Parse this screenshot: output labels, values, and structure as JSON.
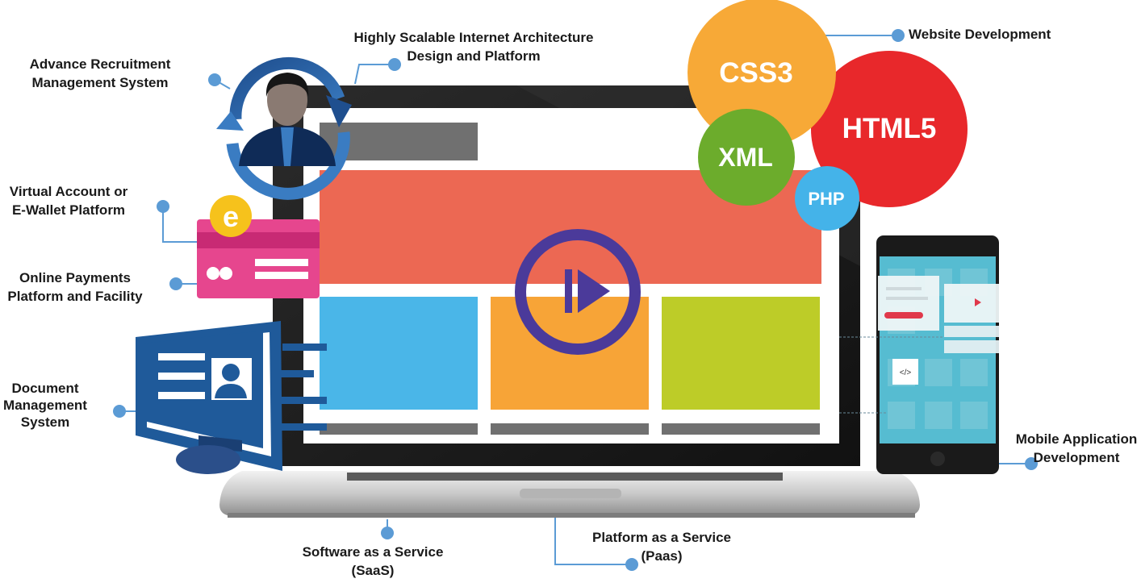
{
  "labels": {
    "recruitment": [
      "Advance Recruitment",
      "Management System"
    ],
    "architecture": [
      "Highly Scalable Internet Architecture",
      "Design and Platform"
    ],
    "website": "Website Development",
    "wallet": [
      "Virtual Account or",
      "E-Wallet Platform"
    ],
    "payments": [
      "Online Payments",
      "Platform and Facility"
    ],
    "document": [
      "Document",
      "Management",
      "System"
    ],
    "mobile": [
      "Mobile Application",
      "Development"
    ],
    "saas": [
      "Software as a Service",
      "(SaaS)"
    ],
    "paas": [
      "Platform as a Service",
      "(Paas)"
    ]
  },
  "bubbles": {
    "css": "CSS3",
    "html": "HTML5",
    "xml": "XML",
    "php": "PHP"
  },
  "icons": {
    "wallet_badge": "e",
    "code_tag": "</>"
  },
  "colors": {
    "accent_blue": "#5b9bd5",
    "css_orange": "#f7a937",
    "html_red": "#e8282b",
    "xml_green": "#6cac2c",
    "php_blue": "#44b3e9",
    "hero_red": "#ec6853",
    "tile_blue": "#4ab6e8",
    "tile_orange": "#f7a437",
    "tile_green": "#bdcc28",
    "card_pink": "#e6468e",
    "doc_blue": "#1f5a9a",
    "play_purple": "#4b3a9a"
  }
}
